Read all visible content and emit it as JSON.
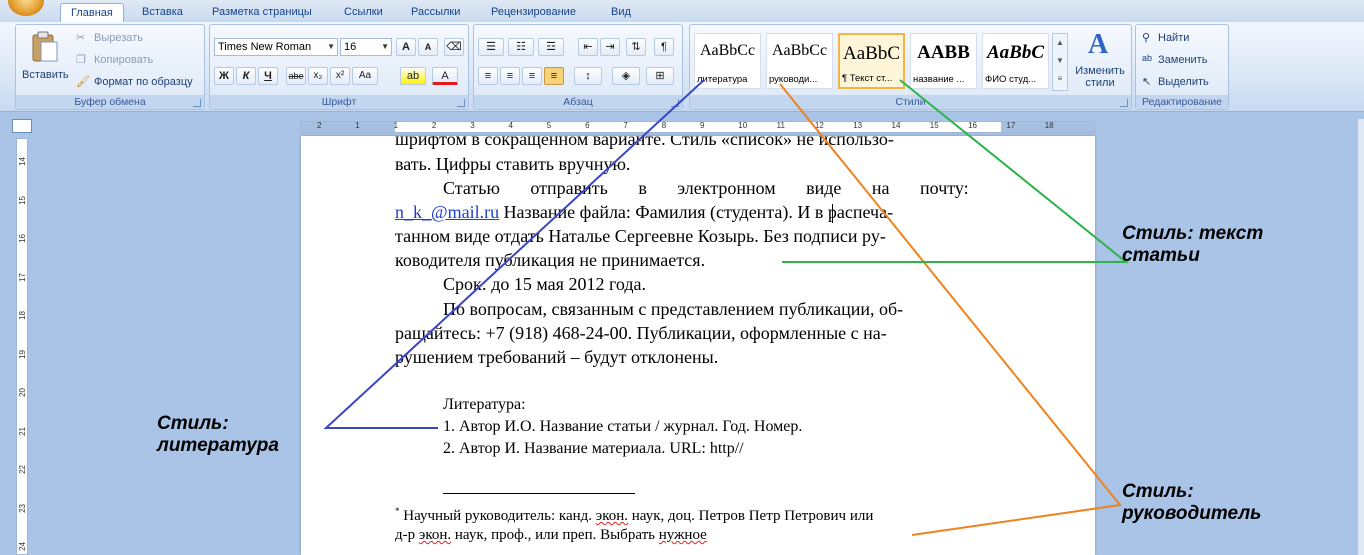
{
  "ribbon": {
    "tabs": [
      "Главная",
      "Вставка",
      "Разметка страницы",
      "Ссылки",
      "Рассылки",
      "Рецензирование",
      "Вид"
    ],
    "clipboard": {
      "paste": "Вставить",
      "cut": "Вырезать",
      "copy": "Копировать",
      "format_painter": "Формат по образцу",
      "label": "Буфер обмена"
    },
    "font": {
      "name": "Times New Roman",
      "size": "16",
      "label": "Шрифт",
      "bold": "Ж",
      "italic": "К",
      "underline": "Ч",
      "strike": "abe",
      "sub": "x₂",
      "sup": "x²",
      "case": "Aa",
      "grow": "A",
      "shrink": "A"
    },
    "paragraph": {
      "label": "Абзац"
    },
    "styles": {
      "label": "Стили",
      "items": [
        {
          "sample": "AaBbCc",
          "name": "литература"
        },
        {
          "sample": "AaBbCc",
          "name": "руководи..."
        },
        {
          "sample": "AaBbC",
          "name": "¶ Текст ст..."
        },
        {
          "sample": "AABB",
          "name": "название ..."
        },
        {
          "sample": "AaBbC",
          "name": "ФИО студ..."
        }
      ],
      "change": "Изменить стили"
    },
    "editing": {
      "label": "Редактирование",
      "find": "Найти",
      "replace": "Заменить",
      "select": "Выделить"
    }
  },
  "ruler": {
    "h_numbers": [
      "2",
      "1",
      "1",
      "2",
      "3",
      "4",
      "5",
      "6",
      "7",
      "8",
      "9",
      "10",
      "11",
      "12",
      "13",
      "14",
      "15",
      "16",
      "17",
      "18"
    ],
    "v_numbers": [
      "14",
      "15",
      "16",
      "17",
      "18",
      "19",
      "20",
      "21",
      "22",
      "23",
      "24"
    ]
  },
  "document": {
    "line1": "шрифтом в сокращенном варианте. Стиль «список» не использо-",
    "line2": "вать. Цифры ставить вручную.",
    "line3": "Статью отправить в электронном виде на почту:",
    "email": "n_k_@mail.ru",
    "line4_rest": " Название файла: Фамилия (студента). И в распеча-",
    "line5": "танном виде отдать Наталье Сергеевне Козырь. Без подписи ру-",
    "line6": "ководителя публикация не принимается.",
    "line7": "Срок: до 15 мая 2012 года.",
    "line8": "По вопросам, связанным с представлением публикации, об-",
    "line9": "ращайтесь: +7 (918) 468-24-00. Публикации, оформленные с на-",
    "line10": "рушением требований – будут отклонены.",
    "lit_title": "Литература:",
    "lit_1": "1. Автор И.О. Название статьи / журнал. Год. Номер.",
    "lit_2": "2. Автор И. Название материала. URL: http//",
    "footnote_mark": "*",
    "footnote_1a": " Научный руководитель: канд. ",
    "footnote_1b": "экон.",
    "footnote_1c": " наук, доц. Петров Петр Петрович или",
    "footnote_2a": "д-р ",
    "footnote_2b": "экон.",
    "footnote_2c": " наук, проф., или преп. Выбрать ",
    "footnote_2d": "нужное"
  },
  "annotations": {
    "literature": [
      "Стиль:",
      "литература"
    ],
    "text": [
      "Стиль: текст",
      "статьи"
    ],
    "advisor": [
      "Стиль:",
      "руководитель"
    ],
    "colors": {
      "literature": "#3a47c4",
      "text": "#2db34a",
      "advisor": "#f0821e"
    }
  }
}
